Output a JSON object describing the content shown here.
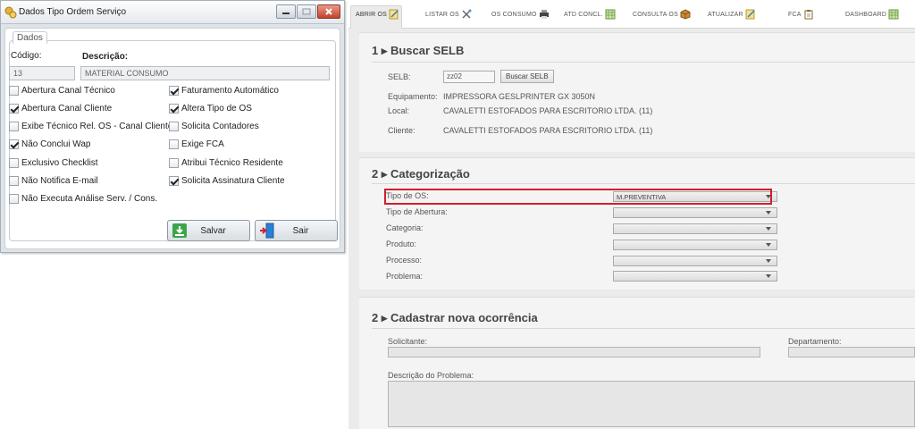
{
  "dialog": {
    "title": "Dados Tipo Ordem Serviço",
    "group_label": "Dados",
    "codigo_label": "Código:",
    "descricao_label": "Descrição:",
    "codigo_value": "13",
    "descricao_value": "MATERIAL CONSUMO",
    "checkboxes": [
      {
        "label": "Abertura Canal Técnico",
        "checked": false
      },
      {
        "label": "Faturamento Automático",
        "checked": true
      },
      {
        "label": "Abertura Canal Cliente",
        "checked": true
      },
      {
        "label": "Altera Tipo de OS",
        "checked": true
      },
      {
        "label": "Exibe Técnico Rel. OS - Canal Cliente",
        "checked": false
      },
      {
        "label": "Solicita Contadores",
        "checked": false
      },
      {
        "label": "Não Conclui Wap",
        "checked": true
      },
      {
        "label": "Exige FCA",
        "checked": false
      },
      {
        "label": "Exclusivo Checklist",
        "checked": false
      },
      {
        "label": "Atribui Técnico Residente",
        "checked": false
      },
      {
        "label": "Não Notifica E-mail",
        "checked": false
      },
      {
        "label": "Solicita Assinatura Cliente",
        "checked": true
      },
      {
        "label": "Não Executa Análise Serv. / Cons.",
        "checked": false
      }
    ],
    "save_label": "Salvar",
    "exit_label": "Sair"
  },
  "nav": {
    "items": [
      "ABRIR OS",
      "LISTAR OS",
      "OS CONSUMO",
      "ATD CONCL.",
      "CONSULTA OS",
      "ATUALIZAR",
      "FCA",
      "DASHBOARD"
    ]
  },
  "buscar": {
    "title": "1 ▸ Buscar SELB",
    "selb_label": "SELB:",
    "selb_value": "zz02",
    "button_label": "Buscar SELB",
    "equipamento_label": "Equipamento:",
    "equipamento_value": "IMPRESSORA GESLPRINTER GX 3050N",
    "local_label": "Local:",
    "local_value": "CAVALETTI ESTOFADOS PARA ESCRITORIO LTDA. (11)",
    "cliente_label": "Cliente:",
    "cliente_value": "CAVALETTI ESTOFADOS PARA ESCRITORIO LTDA. (11)"
  },
  "categorizacao": {
    "title": "2 ▸ Categorização",
    "fields": [
      {
        "label": "Tipo de OS:",
        "value": "M.PREVENTIVA"
      },
      {
        "label": "Tipo de Abertura:",
        "value": ""
      },
      {
        "label": "Categoria:",
        "value": ""
      },
      {
        "label": "Produto:",
        "value": ""
      },
      {
        "label": "Processo:",
        "value": ""
      },
      {
        "label": "Problema:",
        "value": ""
      }
    ]
  },
  "ocorrencia": {
    "title": "2 ▸ Cadastrar nova ocorrência",
    "solicitante_label": "Solicitante:",
    "departamento_label": "Departamento:",
    "descricao_label": "Descrição do Problema:"
  },
  "colors": {
    "highlight": "#d0202a",
    "save_icon": "#3aa64a",
    "exit_icon": "#2b7fd4"
  }
}
